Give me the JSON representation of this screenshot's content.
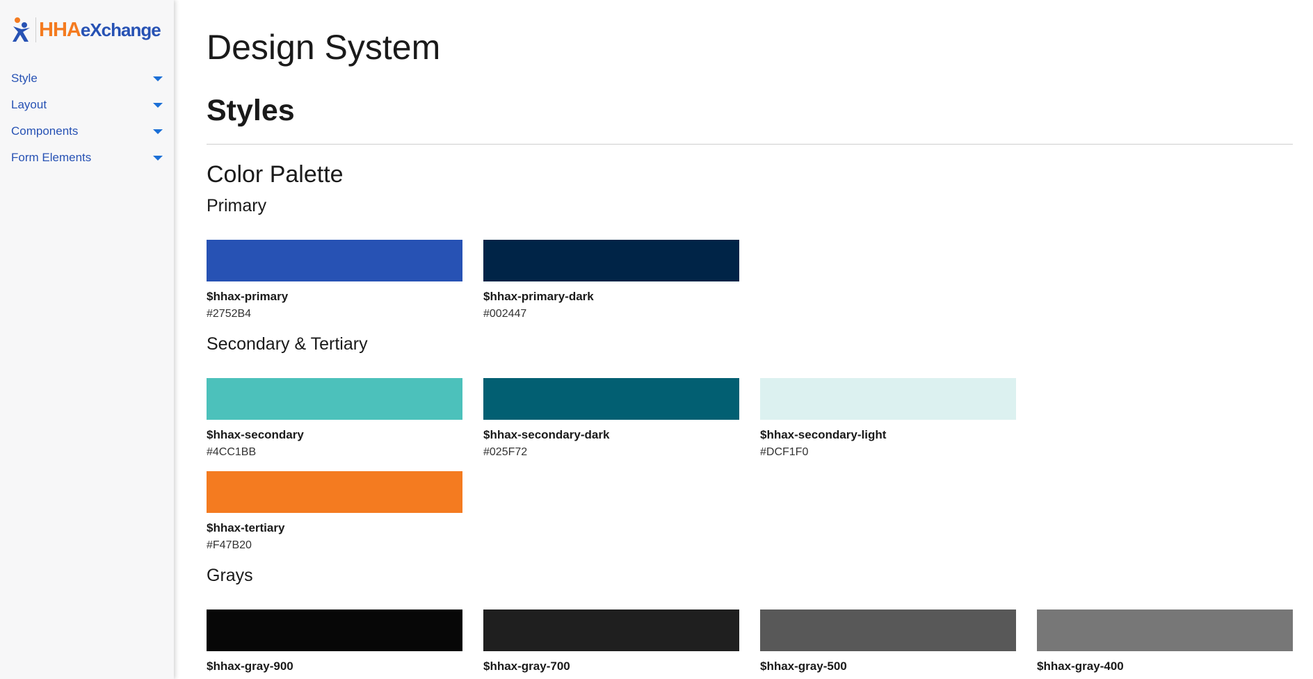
{
  "brand": {
    "logo_text_a": "HHA",
    "logo_text_b": "eXchange"
  },
  "sidebar": {
    "items": [
      {
        "label": "Style"
      },
      {
        "label": "Layout"
      },
      {
        "label": "Components"
      },
      {
        "label": "Form Elements"
      }
    ]
  },
  "main": {
    "page_title": "Design System",
    "section_title": "Styles",
    "palette_title": "Color Palette",
    "groups": {
      "primary": "Primary",
      "secondary": "Secondary & Tertiary",
      "grays": "Grays"
    },
    "swatches": {
      "primary": {
        "name": "$hhax-primary",
        "hex": "#2752B4",
        "color": "#2752B4"
      },
      "primary_dark": {
        "name": "$hhax-primary-dark",
        "hex": "#002447",
        "color": "#002447"
      },
      "secondary": {
        "name": "$hhax-secondary",
        "hex": "#4CC1BB",
        "color": "#4CC1BB"
      },
      "secondary_dark": {
        "name": "$hhax-secondary-dark",
        "hex": "#025F72",
        "color": "#025F72"
      },
      "secondary_light": {
        "name": "$hhax-secondary-light",
        "hex": "#DCF1F0",
        "color": "#DCF1F0"
      },
      "tertiary": {
        "name": "$hhax-tertiary",
        "hex": "#F47B20",
        "color": "#F47B20"
      },
      "gray_900": {
        "name": "$hhax-gray-900",
        "color": "#070707"
      },
      "gray_700": {
        "name": "$hhax-gray-700",
        "color": "#1F1F1F"
      },
      "gray_500": {
        "name": "$hhax-gray-500",
        "color": "#585858"
      },
      "gray_400": {
        "name": "$hhax-gray-400",
        "color": "#777777"
      }
    }
  }
}
